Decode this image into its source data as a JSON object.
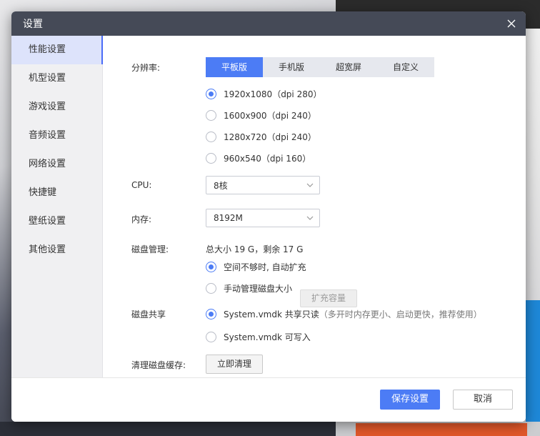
{
  "window": {
    "title": "设置",
    "close_icon": "close-icon"
  },
  "sidebar": {
    "items": [
      {
        "label": "性能设置",
        "active": true
      },
      {
        "label": "机型设置"
      },
      {
        "label": "游戏设置"
      },
      {
        "label": "音频设置"
      },
      {
        "label": "网络设置"
      },
      {
        "label": "快捷键"
      },
      {
        "label": "壁纸设置"
      },
      {
        "label": "其他设置"
      }
    ]
  },
  "resolution": {
    "label": "分辨率:",
    "tabs": [
      "平板版",
      "手机版",
      "超宽屏",
      "自定义"
    ],
    "selected_tab": "平板版",
    "options": [
      {
        "value": "1920x1080",
        "dpi": "（dpi 280）",
        "selected": true
      },
      {
        "value": "1600x900",
        "dpi": "（dpi 240）"
      },
      {
        "value": "1280x720",
        "dpi": "（dpi 240）"
      },
      {
        "value": "960x540",
        "dpi": "（dpi 160）"
      }
    ]
  },
  "cpu": {
    "label": "CPU:",
    "value": "8核"
  },
  "memory": {
    "label": "内存:",
    "value": "8192M"
  },
  "disk": {
    "label": "磁盘管理:",
    "summary": "总大小 19 G，剩余 17 G",
    "auto_expand": "空间不够时, 自动扩充",
    "manual": "手动管理磁盘大小",
    "expand_button": "扩充容量"
  },
  "disk_share": {
    "label": "磁盘共享",
    "readonly": "System.vmdk 共享只读",
    "readonly_hint": "（多开时内存更小、启动更快，推荐使用）",
    "writable": "System.vmdk 可写入"
  },
  "cache": {
    "label": "清理磁盘缓存:",
    "button": "立即清理"
  },
  "footer": {
    "save": "保存设置",
    "cancel": "取消"
  },
  "colors": {
    "accent": "#4c7cf5",
    "titlebar": "#454a57",
    "sidebar_active": "#dde3fb"
  }
}
